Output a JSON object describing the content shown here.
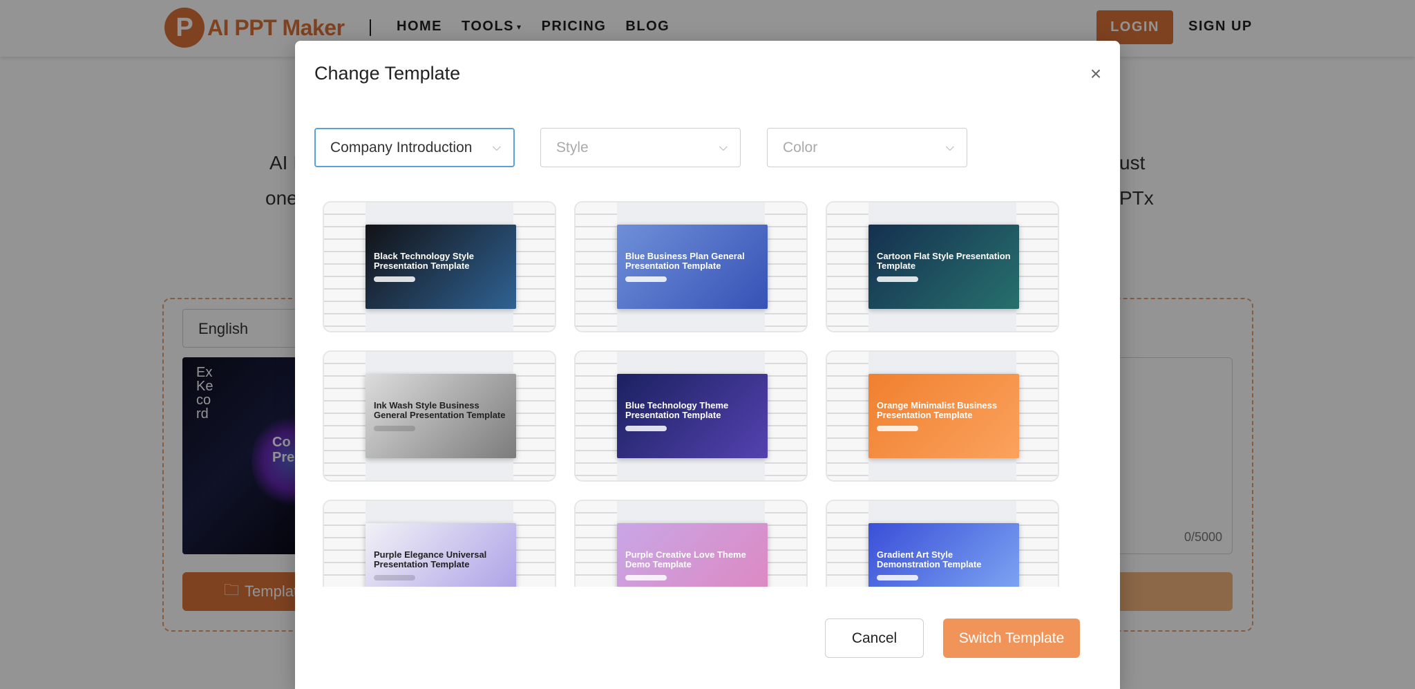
{
  "nav": {
    "logo_letter": "P",
    "logo_text": "AI PPT Maker",
    "links": [
      "HOME",
      "TOOLS",
      "PRICING",
      "BLOG"
    ],
    "login": "LOGIN",
    "signup": "SIGN UP",
    "brand_color": "#d9733a"
  },
  "background": {
    "line1_left": "AI I",
    "line1_right": "ust",
    "line2_left": "one",
    "line2_right": "PTx",
    "language_select": "English",
    "thumb_text_1": "Ex Ke co rd",
    "thumb_text_2": "Co Pre",
    "template_button": "Templat",
    "char_counter": "0/5000"
  },
  "modal": {
    "title": "Change Template",
    "filters": [
      {
        "value": "Company Introduction",
        "placeholder": false
      },
      {
        "value": "Style",
        "placeholder": true
      },
      {
        "value": "Color",
        "placeholder": true
      }
    ],
    "templates": [
      {
        "title": "Black Technology Style Presentation Template",
        "bg": "#121216",
        "accent": "#3b82c4"
      },
      {
        "title": "Blue Business Plan General Presentation Template",
        "bg": "#6f8fd8",
        "accent": "#1f3aa8"
      },
      {
        "title": "Cartoon Flat Style Presentation Template",
        "bg": "#15304f",
        "accent": "#2e8a7a"
      },
      {
        "title": "Ink Wash Style Business General Presentation Template",
        "bg": "#dcdcdc",
        "accent": "#555555"
      },
      {
        "title": "Blue Technology Theme Presentation Template",
        "bg": "#1b2160",
        "accent": "#6b4fd0"
      },
      {
        "title": "Orange Minimalist Business Presentation Template",
        "bg": "#f0802f",
        "accent": "#ffb070"
      },
      {
        "title": "Purple Elegance Universal Presentation Template",
        "bg": "#f1f1f6",
        "accent": "#8b7ae0"
      },
      {
        "title": "Purple Creative Love Theme Demo Template",
        "bg": "#c9a6e6",
        "accent": "#e77ab0"
      },
      {
        "title": "Gradient Art Style Demonstration Template",
        "bg": "#3a4fd8",
        "accent": "#9fd0ff"
      }
    ],
    "cancel": "Cancel",
    "switch": "Switch Template",
    "accent": "#f0945a"
  }
}
